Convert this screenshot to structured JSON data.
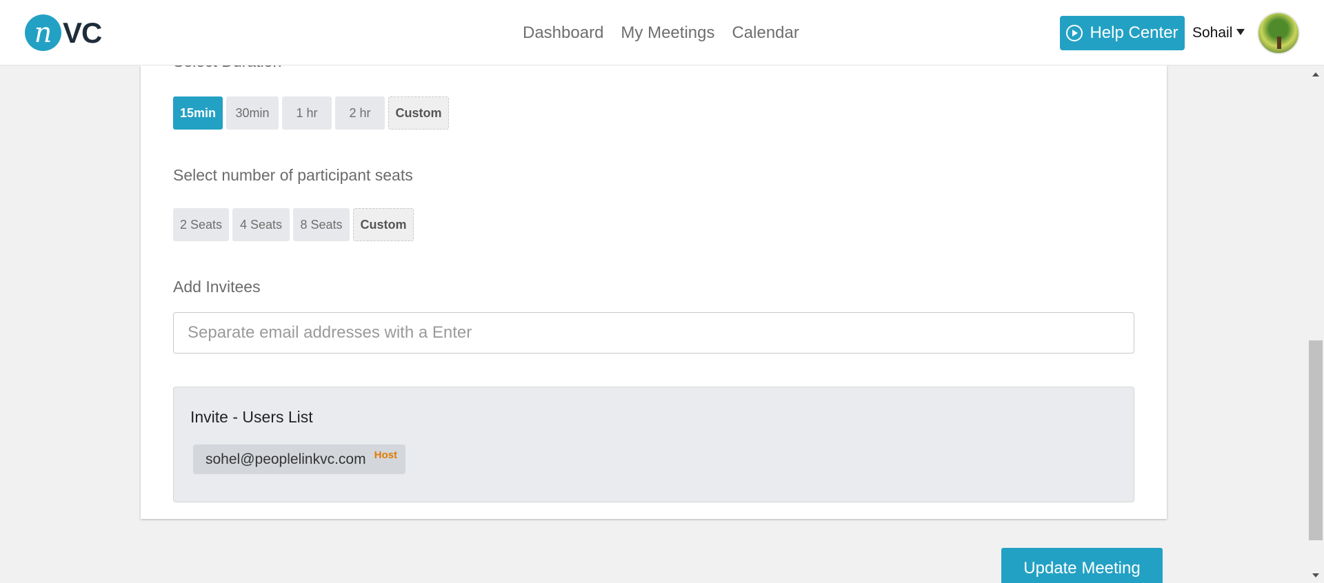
{
  "header": {
    "logo_mark": "n",
    "logo_text": "VC",
    "nav": [
      "Dashboard",
      "My Meetings",
      "Calendar"
    ],
    "help_label": "Help Center",
    "user_name": "Sohail"
  },
  "duration": {
    "label": "Select Duration",
    "options": [
      "15min",
      "30min",
      "1 hr",
      "2 hr",
      "Custom"
    ],
    "selected": "15min"
  },
  "seats": {
    "label": "Select number of participant seats",
    "options": [
      "2 Seats",
      "4 Seats",
      "8 Seats",
      "Custom"
    ]
  },
  "invitees": {
    "label": "Add Invitees",
    "placeholder": "Separate email addresses with a Enter",
    "value": ""
  },
  "users_list": {
    "title": "Invite - Users List",
    "users": [
      {
        "email": "sohel@peoplelinkvc.com",
        "role": "Host"
      }
    ]
  },
  "update_label": "Update Meeting",
  "colors": {
    "accent": "#23a1c4",
    "host": "#e07b00"
  }
}
